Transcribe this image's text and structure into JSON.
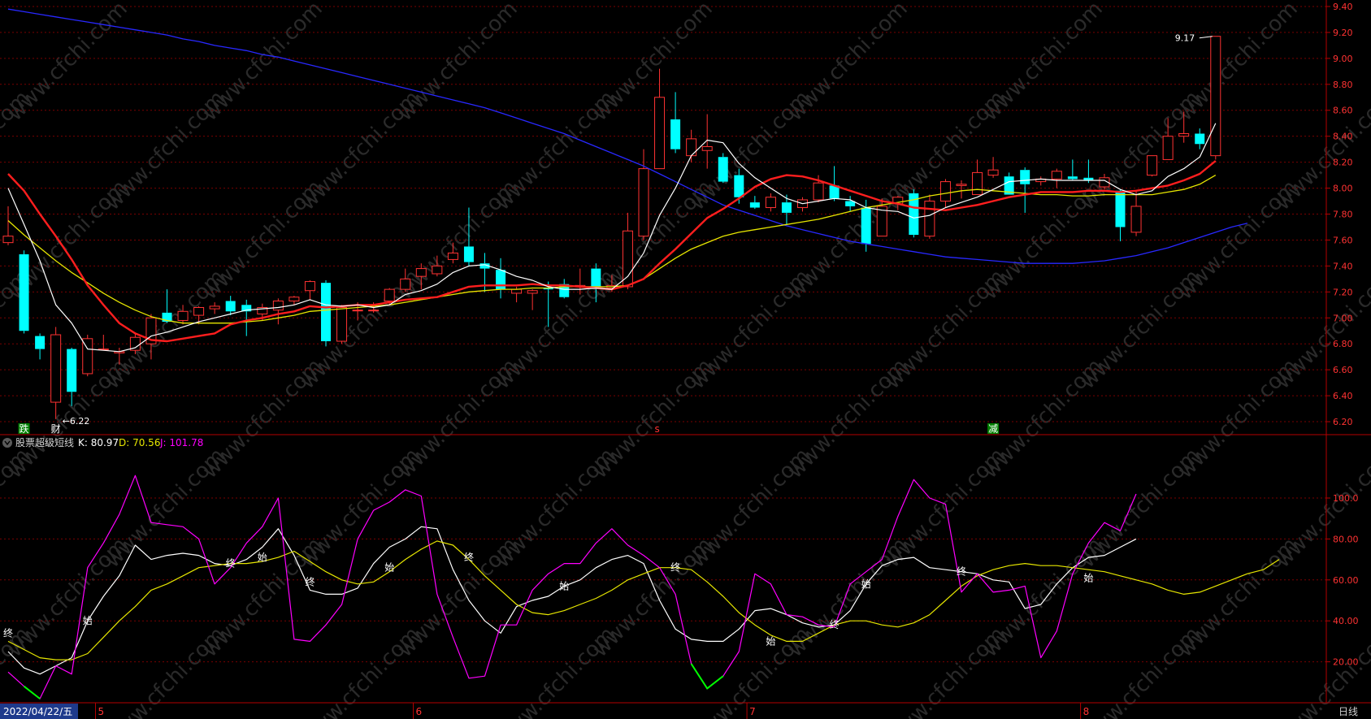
{
  "chart_data": [
    {
      "type": "candlestick",
      "panel": "main",
      "ylim": [
        6.1,
        9.45
      ],
      "y_ticks": [
        "6.20",
        "6.40",
        "6.60",
        "6.80",
        "7.00",
        "7.20",
        "7.40",
        "7.60",
        "7.80",
        "8.00",
        "8.20",
        "8.40",
        "8.60",
        "8.80",
        "9.00",
        "9.20",
        "9.40"
      ],
      "up_color": "#ff3232",
      "down_color": "#00ffff",
      "candles": [
        {
          "o": 7.58,
          "h": 7.86,
          "l": 7.56,
          "c": 7.63
        },
        {
          "o": 7.49,
          "h": 7.52,
          "l": 6.88,
          "c": 6.9
        },
        {
          "o": 6.86,
          "h": 6.88,
          "l": 6.68,
          "c": 6.76
        },
        {
          "o": 6.35,
          "h": 6.93,
          "l": 6.22,
          "c": 6.87
        },
        {
          "o": 6.76,
          "h": 6.77,
          "l": 6.32,
          "c": 6.43
        },
        {
          "o": 6.57,
          "h": 6.87,
          "l": 6.55,
          "c": 6.84
        },
        {
          "o": 6.76,
          "h": 6.87,
          "l": 6.75,
          "c": 6.76
        },
        {
          "o": 6.73,
          "h": 6.77,
          "l": 6.64,
          "c": 6.74
        },
        {
          "o": 6.75,
          "h": 6.88,
          "l": 6.72,
          "c": 6.85
        },
        {
          "o": 6.8,
          "h": 7.03,
          "l": 6.68,
          "c": 7.0
        },
        {
          "o": 7.04,
          "h": 7.22,
          "l": 6.96,
          "c": 6.97
        },
        {
          "o": 6.98,
          "h": 7.1,
          "l": 6.95,
          "c": 7.05
        },
        {
          "o": 7.02,
          "h": 7.09,
          "l": 6.95,
          "c": 7.08
        },
        {
          "o": 7.07,
          "h": 7.12,
          "l": 7.03,
          "c": 7.09
        },
        {
          "o": 7.13,
          "h": 7.17,
          "l": 7.02,
          "c": 7.05
        },
        {
          "o": 7.1,
          "h": 7.14,
          "l": 6.86,
          "c": 7.05
        },
        {
          "o": 7.03,
          "h": 7.11,
          "l": 6.98,
          "c": 7.08
        },
        {
          "o": 7.06,
          "h": 7.15,
          "l": 6.95,
          "c": 7.13
        },
        {
          "o": 7.13,
          "h": 7.17,
          "l": 7.1,
          "c": 7.16
        },
        {
          "o": 7.21,
          "h": 7.29,
          "l": 7.14,
          "c": 7.28
        },
        {
          "o": 7.27,
          "h": 7.29,
          "l": 6.78,
          "c": 6.82
        },
        {
          "o": 6.82,
          "h": 7.1,
          "l": 6.8,
          "c": 7.08
        },
        {
          "o": 7.06,
          "h": 7.12,
          "l": 6.98,
          "c": 7.06
        },
        {
          "o": 7.06,
          "h": 7.12,
          "l": 7.04,
          "c": 7.06
        },
        {
          "o": 7.13,
          "h": 7.23,
          "l": 7.1,
          "c": 7.22
        },
        {
          "o": 7.22,
          "h": 7.38,
          "l": 7.2,
          "c": 7.3
        },
        {
          "o": 7.32,
          "h": 7.42,
          "l": 7.22,
          "c": 7.38
        },
        {
          "o": 7.34,
          "h": 7.48,
          "l": 7.32,
          "c": 7.4
        },
        {
          "o": 7.45,
          "h": 7.58,
          "l": 7.42,
          "c": 7.5
        },
        {
          "o": 7.55,
          "h": 7.85,
          "l": 7.4,
          "c": 7.43
        },
        {
          "o": 7.42,
          "h": 7.5,
          "l": 7.2,
          "c": 7.38
        },
        {
          "o": 7.37,
          "h": 7.46,
          "l": 7.15,
          "c": 7.22
        },
        {
          "o": 7.19,
          "h": 7.24,
          "l": 7.12,
          "c": 7.22
        },
        {
          "o": 7.19,
          "h": 7.22,
          "l": 7.06,
          "c": 7.21
        },
        {
          "o": 7.23,
          "h": 7.28,
          "l": 6.93,
          "c": 7.22
        },
        {
          "o": 7.26,
          "h": 7.3,
          "l": 7.15,
          "c": 7.16
        },
        {
          "o": 7.24,
          "h": 7.38,
          "l": 7.18,
          "c": 7.25
        },
        {
          "o": 7.38,
          "h": 7.42,
          "l": 7.12,
          "c": 7.24
        },
        {
          "o": 7.23,
          "h": 7.33,
          "l": 7.2,
          "c": 7.25
        },
        {
          "o": 7.24,
          "h": 7.81,
          "l": 7.22,
          "c": 7.67
        },
        {
          "o": 7.63,
          "h": 8.3,
          "l": 7.6,
          "c": 8.15
        },
        {
          "o": 8.15,
          "h": 8.92,
          "l": 8.15,
          "c": 8.7
        },
        {
          "o": 8.53,
          "h": 8.74,
          "l": 8.27,
          "c": 8.3
        },
        {
          "o": 8.25,
          "h": 8.45,
          "l": 8.2,
          "c": 8.38
        },
        {
          "o": 8.29,
          "h": 8.57,
          "l": 8.15,
          "c": 8.32
        },
        {
          "o": 8.24,
          "h": 8.27,
          "l": 8.04,
          "c": 8.05
        },
        {
          "o": 8.1,
          "h": 8.15,
          "l": 7.88,
          "c": 7.93
        },
        {
          "o": 7.89,
          "h": 7.94,
          "l": 7.84,
          "c": 7.85
        },
        {
          "o": 7.85,
          "h": 7.96,
          "l": 7.82,
          "c": 7.93
        },
        {
          "o": 7.89,
          "h": 7.95,
          "l": 7.72,
          "c": 7.81
        },
        {
          "o": 7.85,
          "h": 7.93,
          "l": 7.82,
          "c": 7.91
        },
        {
          "o": 7.91,
          "h": 8.1,
          "l": 7.89,
          "c": 8.04
        },
        {
          "o": 8.02,
          "h": 8.17,
          "l": 7.9,
          "c": 7.92
        },
        {
          "o": 7.9,
          "h": 7.94,
          "l": 7.82,
          "c": 7.86
        },
        {
          "o": 7.85,
          "h": 7.91,
          "l": 7.51,
          "c": 7.57
        },
        {
          "o": 7.63,
          "h": 7.92,
          "l": 7.63,
          "c": 7.86
        },
        {
          "o": 7.88,
          "h": 7.94,
          "l": 7.83,
          "c": 7.93
        },
        {
          "o": 7.96,
          "h": 7.99,
          "l": 7.62,
          "c": 7.64
        },
        {
          "o": 7.63,
          "h": 7.95,
          "l": 7.61,
          "c": 7.9
        },
        {
          "o": 7.9,
          "h": 8.07,
          "l": 7.85,
          "c": 8.05
        },
        {
          "o": 8.02,
          "h": 8.06,
          "l": 7.92,
          "c": 8.03
        },
        {
          "o": 7.95,
          "h": 8.22,
          "l": 7.95,
          "c": 8.12
        },
        {
          "o": 8.1,
          "h": 8.24,
          "l": 8.08,
          "c": 8.14
        },
        {
          "o": 8.09,
          "h": 8.12,
          "l": 7.95,
          "c": 7.95
        },
        {
          "o": 8.14,
          "h": 8.16,
          "l": 7.81,
          "c": 8.03
        },
        {
          "o": 8.05,
          "h": 8.09,
          "l": 8.02,
          "c": 8.07
        },
        {
          "o": 8.07,
          "h": 8.15,
          "l": 8.0,
          "c": 8.13
        },
        {
          "o": 8.09,
          "h": 8.22,
          "l": 8.06,
          "c": 8.07
        },
        {
          "o": 8.08,
          "h": 8.22,
          "l": 8.04,
          "c": 8.06
        },
        {
          "o": 8.01,
          "h": 8.11,
          "l": 7.99,
          "c": 8.08
        },
        {
          "o": 7.98,
          "h": 7.99,
          "l": 7.59,
          "c": 7.7
        },
        {
          "o": 7.66,
          "h": 7.98,
          "l": 7.63,
          "c": 7.86
        },
        {
          "o": 8.1,
          "h": 8.25,
          "l": 8.09,
          "c": 8.25
        },
        {
          "o": 8.22,
          "h": 8.54,
          "l": 8.22,
          "c": 8.4
        },
        {
          "o": 8.4,
          "h": 8.59,
          "l": 8.35,
          "c": 8.42
        },
        {
          "o": 8.42,
          "h": 8.46,
          "l": 8.3,
          "c": 8.34
        },
        {
          "o": 8.25,
          "h": 9.17,
          "l": 8.22,
          "c": 9.17
        }
      ],
      "ma5": [
        8.0,
        7.72,
        7.44,
        7.1,
        6.96,
        6.76,
        6.75,
        6.74,
        6.77,
        6.86,
        6.89,
        6.93,
        6.97,
        7.0,
        7.03,
        7.06,
        7.07,
        7.08,
        7.1,
        7.14,
        7.1,
        7.09,
        7.1,
        7.08,
        7.1,
        7.18,
        7.21,
        7.26,
        7.35,
        7.4,
        7.41,
        7.37,
        7.32,
        7.29,
        7.24,
        7.22,
        7.22,
        7.23,
        7.22,
        7.32,
        7.5,
        7.79,
        8.0,
        8.25,
        8.37,
        8.35,
        8.19,
        8.08,
        8.0,
        7.92,
        7.88,
        7.9,
        7.92,
        7.91,
        7.85,
        7.83,
        7.82,
        7.77,
        7.79,
        7.85,
        7.89,
        7.93,
        7.99,
        8.05,
        8.06,
        8.07,
        8.06,
        8.06,
        8.06,
        8.06,
        7.99,
        7.95,
        7.98,
        8.09,
        8.15,
        8.24,
        8.5
      ],
      "ma10": [
        8.11,
        7.98,
        7.8,
        7.63,
        7.45,
        7.25,
        7.1,
        6.96,
        6.88,
        6.83,
        6.82,
        6.84,
        6.86,
        6.88,
        6.95,
        6.98,
        7.0,
        7.03,
        7.05,
        7.09,
        7.08,
        7.09,
        7.1,
        7.1,
        7.12,
        7.14,
        7.15,
        7.16,
        7.2,
        7.24,
        7.25,
        7.25,
        7.25,
        7.26,
        7.25,
        7.25,
        7.24,
        7.23,
        7.22,
        7.25,
        7.3,
        7.42,
        7.53,
        7.65,
        7.77,
        7.84,
        7.92,
        8.01,
        8.07,
        8.1,
        8.09,
        8.06,
        8.02,
        7.98,
        7.94,
        7.9,
        7.88,
        7.85,
        7.84,
        7.83,
        7.85,
        7.87,
        7.9,
        7.93,
        7.95,
        7.97,
        7.97,
        7.97,
        7.98,
        7.98,
        7.97,
        7.98,
        8.0,
        8.02,
        8.06,
        8.11,
        8.21
      ],
      "ma20": [
        7.75,
        7.64,
        7.54,
        7.44,
        7.35,
        7.27,
        7.19,
        7.12,
        7.06,
        7.01,
        6.98,
        6.96,
        6.96,
        6.96,
        6.96,
        6.97,
        6.98,
        7.0,
        7.02,
        7.05,
        7.06,
        7.07,
        7.08,
        7.09,
        7.1,
        7.12,
        7.14,
        7.16,
        7.18,
        7.2,
        7.21,
        7.22,
        7.22,
        7.23,
        7.23,
        7.24,
        7.24,
        7.24,
        7.24,
        7.25,
        7.3,
        7.38,
        7.46,
        7.53,
        7.58,
        7.63,
        7.66,
        7.68,
        7.7,
        7.72,
        7.74,
        7.76,
        7.79,
        7.82,
        7.85,
        7.87,
        7.89,
        7.91,
        7.94,
        7.96,
        7.98,
        7.99,
        7.98,
        7.97,
        7.96,
        7.95,
        7.95,
        7.94,
        7.94,
        7.95,
        7.95,
        7.95,
        7.95,
        7.97,
        7.99,
        8.03,
        8.1
      ],
      "ma60": [
        9.38,
        9.36,
        9.34,
        9.32,
        9.3,
        9.28,
        9.26,
        9.24,
        9.22,
        9.2,
        9.18,
        9.15,
        9.13,
        9.1,
        9.08,
        9.06,
        9.03,
        9.01,
        8.98,
        8.95,
        8.92,
        8.89,
        8.86,
        8.83,
        8.8,
        8.77,
        8.74,
        8.71,
        8.68,
        8.65,
        8.62,
        8.58,
        8.54,
        8.5,
        8.46,
        8.42,
        8.37,
        8.32,
        8.27,
        8.22,
        8.17,
        8.11,
        8.05,
        7.99,
        7.93,
        7.87,
        7.83,
        7.79,
        7.75,
        7.71,
        7.68,
        7.65,
        7.62,
        7.59,
        7.57,
        7.55,
        7.53,
        7.51,
        7.49,
        7.47,
        7.46,
        7.45,
        7.44,
        7.43,
        7.42,
        7.42,
        7.42,
        7.42,
        7.43,
        7.44,
        7.46,
        7.48,
        7.51,
        7.54,
        7.58,
        7.62,
        7.66,
        7.7,
        7.73
      ],
      "annotations": {
        "high": "9.17",
        "low": "6.22"
      },
      "bottom_tags": [
        {
          "text": "跌",
          "color": "#ffffff",
          "bg": "#008000",
          "index": 1
        },
        {
          "text": "财",
          "color": "#ffffff",
          "bg": "#000000",
          "index": 3
        },
        {
          "text": "s",
          "color": "#ff3232",
          "bg": "#000000",
          "index": 41
        },
        {
          "text": "减",
          "color": "#ffffff",
          "bg": "#008000",
          "index": 62
        }
      ]
    },
    {
      "type": "line",
      "panel": "indicator",
      "title": "股票超级短线",
      "ylim": [
        0,
        125
      ],
      "y_ticks": [
        "20.00",
        "40.00",
        "60.00",
        "80.00",
        "100.0"
      ],
      "series": [
        {
          "name": "K",
          "color": "#ffffff",
          "last": "80.97",
          "values": [
            25,
            17,
            14,
            18,
            22,
            40,
            52,
            62,
            77,
            70,
            72,
            73,
            72,
            68,
            67,
            70,
            76,
            85,
            72,
            55,
            53,
            53,
            56,
            68,
            76,
            80,
            86,
            85,
            65,
            50,
            40,
            34,
            47,
            50,
            52,
            57,
            60,
            66,
            70,
            72,
            68,
            50,
            36,
            31,
            30,
            30,
            36,
            45,
            46,
            43,
            39,
            37,
            38,
            45,
            58,
            67,
            70,
            71,
            66,
            65,
            64,
            63,
            60,
            59,
            46,
            48,
            58,
            66,
            71,
            72,
            76,
            80
          ]
        },
        {
          "name": "D",
          "color": "#e6e600",
          "last": "70.56",
          "values": [
            30,
            26,
            22,
            21,
            21,
            24,
            32,
            40,
            47,
            55,
            58,
            62,
            66,
            67,
            68,
            68,
            69,
            71,
            74,
            69,
            64,
            60,
            58,
            59,
            64,
            70,
            75,
            79,
            77,
            70,
            62,
            55,
            48,
            44,
            43,
            45,
            48,
            51,
            55,
            60,
            63,
            66,
            66,
            65,
            59,
            52,
            44,
            38,
            33,
            30,
            30,
            34,
            38,
            40,
            40,
            38,
            37,
            39,
            43,
            50,
            57,
            62,
            65,
            67,
            68,
            67,
            67,
            66,
            65,
            64,
            62,
            60,
            58,
            55,
            53,
            54,
            57,
            60,
            63,
            65,
            70
          ]
        },
        {
          "name": "J",
          "color": "#ff00ff",
          "last": "101.78",
          "values": [
            15,
            8,
            2,
            18,
            14,
            66,
            78,
            92,
            111,
            88,
            87,
            86,
            80,
            58,
            66,
            78,
            86,
            100,
            31,
            30,
            38,
            48,
            80,
            94,
            98,
            104,
            101,
            53,
            32,
            12,
            13,
            38,
            38,
            55,
            63,
            68,
            68,
            78,
            85,
            77,
            72,
            66,
            53,
            19,
            7,
            13,
            25,
            63,
            58,
            43,
            42,
            38,
            37,
            58,
            64,
            70,
            91,
            109,
            100,
            97,
            54,
            63,
            54,
            55,
            57,
            22,
            35,
            63,
            78,
            88,
            84,
            102
          ]
        }
      ],
      "markers": [
        {
          "text": "终",
          "index": 0,
          "value": 34
        },
        {
          "text": "始",
          "index": 5,
          "value": 40
        },
        {
          "text": "终",
          "index": 14,
          "value": 68
        },
        {
          "text": "始",
          "index": 16,
          "value": 71
        },
        {
          "text": "终",
          "index": 19,
          "value": 59
        },
        {
          "text": "始",
          "index": 24,
          "value": 66
        },
        {
          "text": "终",
          "index": 29,
          "value": 71
        },
        {
          "text": "始",
          "index": 35,
          "value": 57
        },
        {
          "text": "终",
          "index": 42,
          "value": 66
        },
        {
          "text": "始",
          "index": 48,
          "value": 30
        },
        {
          "text": "终",
          "index": 52,
          "value": 38
        },
        {
          "text": "始",
          "index": 54,
          "value": 58
        },
        {
          "text": "终",
          "index": 60,
          "value": 64
        },
        {
          "text": "始",
          "index": 68,
          "value": 61
        }
      ],
      "green_segments": [
        [
          1,
          2
        ],
        [
          43,
          45
        ]
      ]
    }
  ],
  "x_axis": {
    "date_label": "2022/04/22/五",
    "month_ticks": [
      {
        "label": "5",
        "index": 6
      },
      {
        "label": "6",
        "index": 26
      },
      {
        "label": "7",
        "index": 47
      },
      {
        "label": "8",
        "index": 68
      }
    ],
    "period_label": "日线"
  },
  "indicator_header": {
    "name": "股票超级短线",
    "k_label": "K: 80.97",
    "d_label": "D: 70.56",
    "j_label": "J: 101.78"
  },
  "watermark": "www.cfchi.com",
  "colors": {
    "background": "#000000",
    "grid": "#7a0000",
    "axis_line": "#b40000",
    "axis_text": "#ff3232",
    "ma5": "#ffffff",
    "ma10": "#ff1e1e",
    "ma20": "#e6e600",
    "ma60": "#2828ff"
  }
}
